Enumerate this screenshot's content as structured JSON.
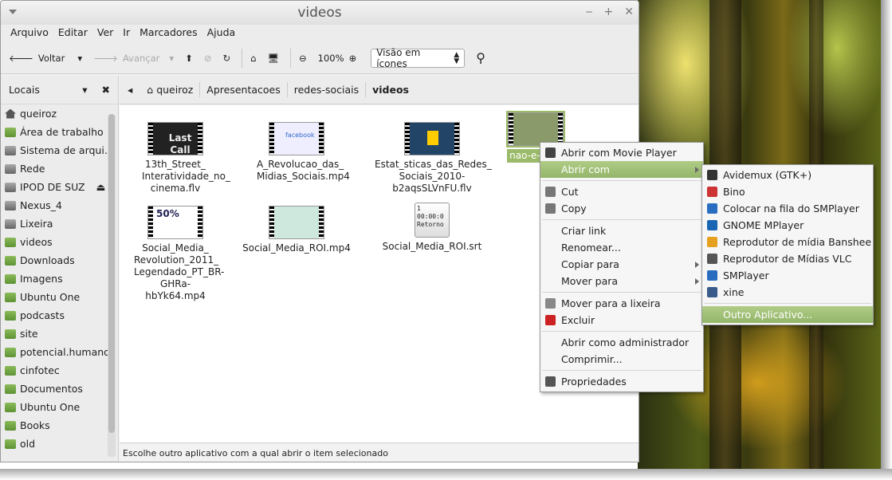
{
  "window": {
    "title": "videos"
  },
  "menubar": [
    "Arquivo",
    "Editar",
    "Ver",
    "Ir",
    "Marcadores",
    "Ajuda"
  ],
  "toolbar": {
    "back": "Voltar",
    "forward": "Avançar",
    "zoom": "100%",
    "view": "Visão em ícones"
  },
  "sidebar": {
    "header": "Locais",
    "items": [
      {
        "label": "queiroz",
        "icon": "home-icon"
      },
      {
        "label": "Área de trabalho",
        "icon": "desktop-icon"
      },
      {
        "label": "Sistema de arqui…",
        "icon": "drive-icon"
      },
      {
        "label": "Rede",
        "icon": "network-icon"
      },
      {
        "label": "IPOD DE SUZ",
        "icon": "drive-icon"
      },
      {
        "label": "Nexus_4",
        "icon": "drive-icon"
      },
      {
        "label": "Lixeira",
        "icon": "trash-icon"
      },
      {
        "label": "videos",
        "icon": "folder-icon"
      },
      {
        "label": "Downloads",
        "icon": "folder-icon"
      },
      {
        "label": "Imagens",
        "icon": "folder-icon"
      },
      {
        "label": "Ubuntu One",
        "icon": "folder-icon"
      },
      {
        "label": "podcasts",
        "icon": "folder-icon"
      },
      {
        "label": "site",
        "icon": "folder-icon"
      },
      {
        "label": "potencial.humano",
        "icon": "folder-icon"
      },
      {
        "label": "cinfotec",
        "icon": "folder-icon"
      },
      {
        "label": "Documentos",
        "icon": "folder-icon"
      },
      {
        "label": "Ubuntu One",
        "icon": "folder-icon"
      },
      {
        "label": "Books",
        "icon": "folder-icon"
      },
      {
        "label": "old",
        "icon": "folder-icon"
      }
    ]
  },
  "path": [
    "queiroz",
    "Apresentacoes",
    "redes-sociais",
    "videos"
  ],
  "files": [
    {
      "name": "13th_Street_ Interatividade_no_ cinema.flv",
      "thumb": "Last Call"
    },
    {
      "name": "A_Revolucao_das_ Midias_Sociais.mp4",
      "thumb": "facebook"
    },
    {
      "name": "Estat_sticas_das_Redes_ Sociais_2010- b2aqsSLVnFU.flv",
      "thumb": ""
    },
    {
      "name": "nao-e-un…",
      "thumb": ""
    },
    {
      "name": "Social_Media_ Revolution_2011_ Legendado_PT_BR- GHRa-hbYk64.mp4",
      "thumb": "50%"
    },
    {
      "name": "Social_Media_ROI.mp4",
      "thumb": ""
    },
    {
      "name": "Social_Media_ROI.srt",
      "thumb": "1 00:00:0 Retorno"
    }
  ],
  "status": "Escolhe outro aplicativo com a qual abrir o item selecionado",
  "context_menu": [
    {
      "label": "Abrir com Movie Player",
      "icon": "movie-player-icon"
    },
    {
      "label": "Abrir com",
      "submenu": true,
      "highlight": true
    },
    {
      "sep": true
    },
    {
      "label": "Cut",
      "icon": "cut-icon"
    },
    {
      "label": "Copy",
      "icon": "copy-icon"
    },
    {
      "sep": true
    },
    {
      "label": "Criar link"
    },
    {
      "label": "Renomear..."
    },
    {
      "label": "Copiar para",
      "submenu": true
    },
    {
      "label": "Mover para",
      "submenu": true
    },
    {
      "sep": true
    },
    {
      "label": "Mover para a lixeira",
      "icon": "trash-icon"
    },
    {
      "label": "Excluir",
      "icon": "delete-icon"
    },
    {
      "sep": true
    },
    {
      "label": "Abrir como administrador"
    },
    {
      "label": "Comprimir..."
    },
    {
      "sep": true
    },
    {
      "label": "Propriedades",
      "icon": "properties-icon"
    }
  ],
  "submenu": [
    {
      "label": "Avidemux (GTK+)",
      "icon": "avidemux-icon"
    },
    {
      "label": "Bino",
      "icon": "bino-icon"
    },
    {
      "label": "Colocar na fila do SMPlayer",
      "icon": "smplayer-icon"
    },
    {
      "label": "GNOME MPlayer",
      "icon": "gnome-mplayer-icon"
    },
    {
      "label": "Reprodutor de mídia Banshee",
      "icon": "banshee-icon"
    },
    {
      "label": "Reprodutor de Mídias VLC",
      "icon": "vlc-icon"
    },
    {
      "label": "SMPlayer",
      "icon": "smplayer-icon"
    },
    {
      "label": "xine",
      "icon": "xine-icon"
    },
    {
      "sep": true
    },
    {
      "label": "Outro Aplicativo...",
      "highlight": true
    }
  ]
}
